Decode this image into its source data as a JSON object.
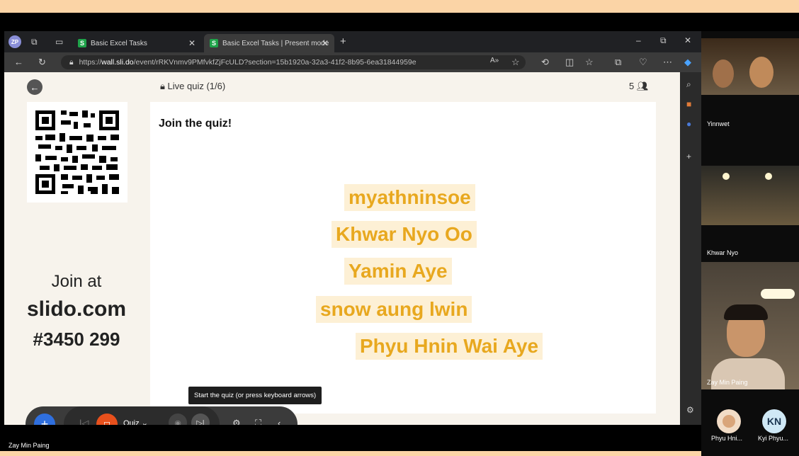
{
  "meeting": {
    "presenter_name": "Zay Min Paing",
    "participants": [
      {
        "name": "Yinnwet"
      },
      {
        "name": "Khwar Nyo"
      },
      {
        "name": "Zay Min Paing"
      },
      {
        "name": "Phyu Hni...",
        "initials": ""
      },
      {
        "name": "Kyi Phyu...",
        "initials": "KN"
      }
    ]
  },
  "browser": {
    "profile_initials": "ZP",
    "tabs": [
      {
        "label": "Basic Excel Tasks"
      },
      {
        "label": "Basic Excel Tasks | Present mode"
      }
    ],
    "url_prefix": "https://",
    "url_host": "wall.sli.do",
    "url_rest": "/event/rRKVnmv9PMfvkfZjFcULD?section=15b1920a-32a3-41f2-8b95-6ea31844959e"
  },
  "slido": {
    "header": "Live quiz (1/6)",
    "participant_count": "5",
    "join_at": "Join at",
    "domain": "slido.com",
    "code": "#3450 299",
    "stage_title": "Join the quiz!",
    "names": [
      "myathninsoe",
      "Khwar Nyo Oo",
      "Yamin Aye",
      "snow aung lwin",
      "Phyu Hnin Wai Aye"
    ],
    "tooltip": "Start the quiz (or press keyboard arrows)",
    "mode_label": "Quiz"
  }
}
